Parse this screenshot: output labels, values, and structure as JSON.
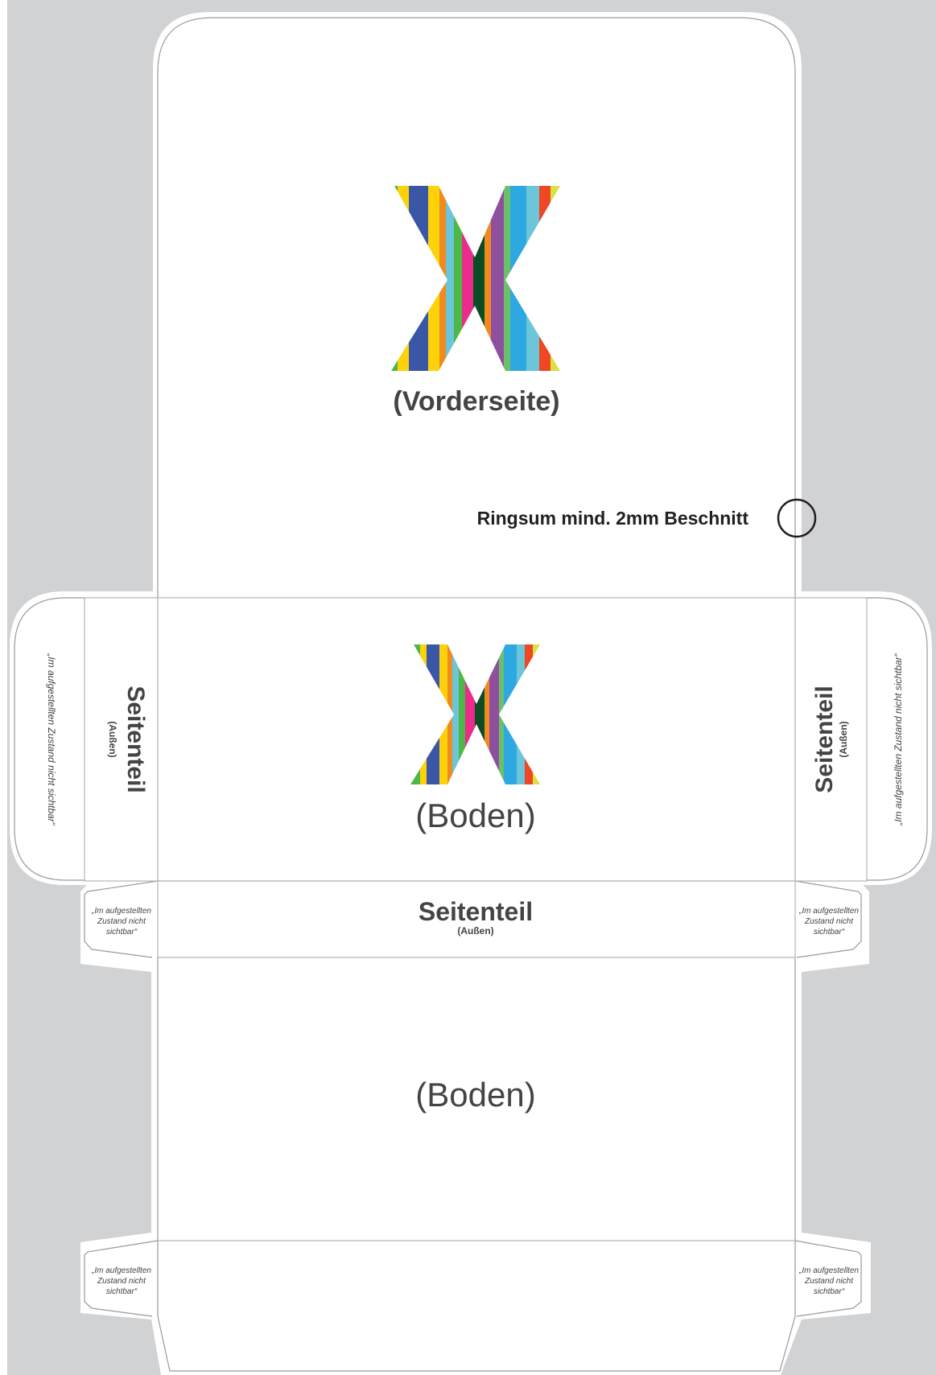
{
  "colors": {
    "background": "#d1d2d4",
    "panel": "#ffffff",
    "outline": "#9a9a9a",
    "label_text": "#444444",
    "note_text": "#231f20",
    "stripes": [
      "#4db848",
      "#3a56a6",
      "#fdd20a",
      "#f08b1f",
      "#6bc6d9",
      "#ec2c8c",
      "#0b4c25",
      "#8f4f9f",
      "#2da8e0",
      "#6cbf6b",
      "#ef4623",
      "#dbe043"
    ]
  },
  "icons": [
    "x-logo-icon",
    "circle-marker-icon"
  ],
  "front": {
    "logo_label": "(Vorderseite)"
  },
  "bleed_note": "Ringsum mind. 2mm Beschnitt",
  "bottom": {
    "logo_label": "(Boden)",
    "label": "(Boden)"
  },
  "side": {
    "title": "Seitenteil",
    "subtitle": "(Außen)"
  },
  "flap_note": "„Im aufgestellten Zustand nicht sichtbar“",
  "tab_note": {
    "line1": "„Im aufgestellten",
    "line2": "Zustand nicht",
    "line3": "sichtbar“"
  }
}
